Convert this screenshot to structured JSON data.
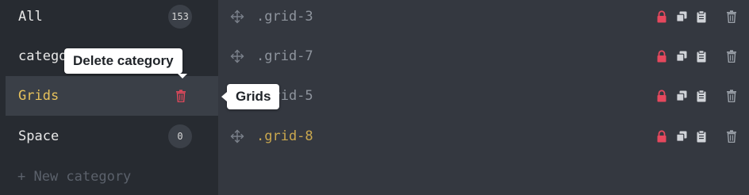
{
  "sidebar": {
    "categories": [
      {
        "label": "All",
        "count": "153"
      },
      {
        "label": "category",
        "count": ""
      },
      {
        "label": "Grids",
        "count": ""
      },
      {
        "label": "Space",
        "count": "0"
      }
    ],
    "new_category_label": "+ New category"
  },
  "tooltips": {
    "delete_category": "Delete category",
    "grids": "Grids"
  },
  "grids": [
    {
      "name": ".grid-3"
    },
    {
      "name": ".grid-7"
    },
    {
      "name": ".grid-5"
    },
    {
      "name": ".grid-8"
    }
  ],
  "colors": {
    "accent_yellow": "#e6c15c",
    "lock_red": "#e5485d",
    "trash_red": "#d9485a"
  }
}
